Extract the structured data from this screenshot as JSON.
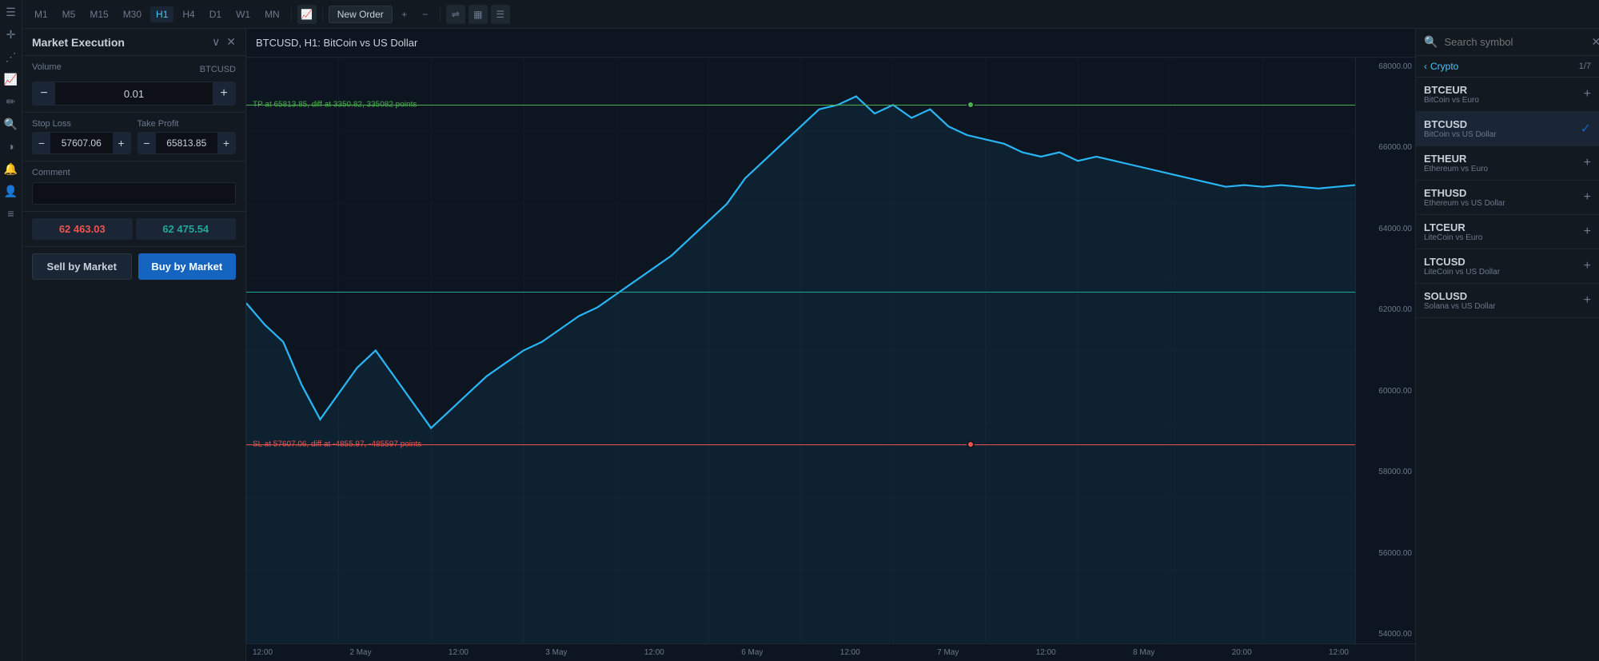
{
  "toolbar": {
    "icons": [
      "≡",
      "⧉",
      "📊",
      "📈",
      "📉",
      "M1",
      "M5",
      "M15",
      "M30",
      "H1",
      "H4",
      "D1",
      "W1",
      "MN"
    ],
    "timeframes": [
      "M1",
      "M5",
      "M15",
      "M30",
      "H1",
      "H4",
      "D1",
      "W1",
      "MN"
    ],
    "active_tf": "H1",
    "new_order": "New Order"
  },
  "left_icons": [
    "≡",
    "✦",
    "📈",
    "✏",
    "🔍",
    "◐",
    "🔔",
    "👤",
    "≡"
  ],
  "order_panel": {
    "title": "Market Execution",
    "volume_label": "Volume",
    "volume_value": "0.01",
    "volume_unit": "BTCUSD",
    "stop_loss_label": "Stop Loss",
    "stop_loss_value": "57607.06",
    "take_profit_label": "Take Profit",
    "take_profit_value": "65813.85",
    "comment_label": "Comment",
    "sell_price": "62 463.03",
    "buy_price": "62 475.54",
    "sell_label": "Sell by Market",
    "buy_label": "Buy by Market"
  },
  "chart": {
    "title": "BTCUSD, H1: BitCoin vs US Dollar",
    "tp_label": "TP at 65813.85, diff at 3350.82, 335082 points",
    "sl_label": "SL at 57607.06, diff at -4855.97, -485597 points",
    "current_price": "62463.03",
    "tp_price": "65813.85",
    "sl_price": "57607.06",
    "price_levels": [
      "68000.00",
      "66000.00",
      "64000.00",
      "62000.00",
      "60000.00",
      "58000.00",
      "56000.00",
      "54000.00"
    ],
    "time_labels": [
      "12:00",
      "2 May",
      "12:00",
      "3 May",
      "12:00",
      "6 May",
      "12:00",
      "7 May",
      "12:00",
      "8 May",
      "20:00",
      "12:00"
    ]
  },
  "symbol_panel": {
    "search_placeholder": "Search symbol",
    "category": "Crypto",
    "count": "1/7",
    "symbols": [
      {
        "name": "BTCEUR",
        "desc": "BitCoin vs Euro",
        "active": false
      },
      {
        "name": "BTCUSD",
        "desc": "BitCoin vs US Dollar",
        "active": true
      },
      {
        "name": "ETHEUR",
        "desc": "Ethereum vs Euro",
        "active": false
      },
      {
        "name": "ETHUSD",
        "desc": "Ethereum vs US Dollar",
        "active": false
      },
      {
        "name": "LTCEUR",
        "desc": "LiteCoin vs Euro",
        "active": false
      },
      {
        "name": "LTCUSD",
        "desc": "LiteCoin vs US Dollar",
        "active": false
      },
      {
        "name": "SOLUSD",
        "desc": "Solana vs US Dollar",
        "active": false
      }
    ]
  }
}
